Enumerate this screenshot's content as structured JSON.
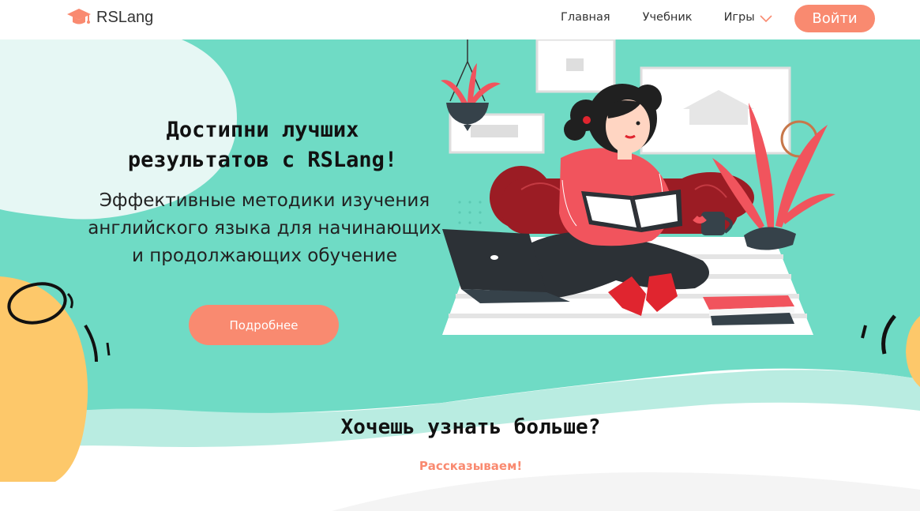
{
  "brand": {
    "name": "RSLang"
  },
  "nav": {
    "home": "Главная",
    "textbook": "Учебник",
    "games": "Игры"
  },
  "header": {
    "login_label": "Войти"
  },
  "hero": {
    "title_line1": "Достипни лучших",
    "title_line2": "результатов с RSLang!",
    "subtitle_line1": "Эффективные методики изучения",
    "subtitle_line2": "английского языка для начинающих",
    "subtitle_line3": "и продолжающих обучение",
    "more_label": "Подробнее"
  },
  "info": {
    "title": "Хочешь узнать больше?",
    "subtitle": "Рассказываем!"
  },
  "colors": {
    "accent": "#f98a70",
    "mint": "#6fdbc5",
    "light_mint": "#e6f7f4",
    "yellow": "#fdc86a",
    "red": "#f1545d"
  },
  "icons": {
    "logo": "graduation-cap-icon",
    "games_dropdown": "chevron-down-icon"
  }
}
